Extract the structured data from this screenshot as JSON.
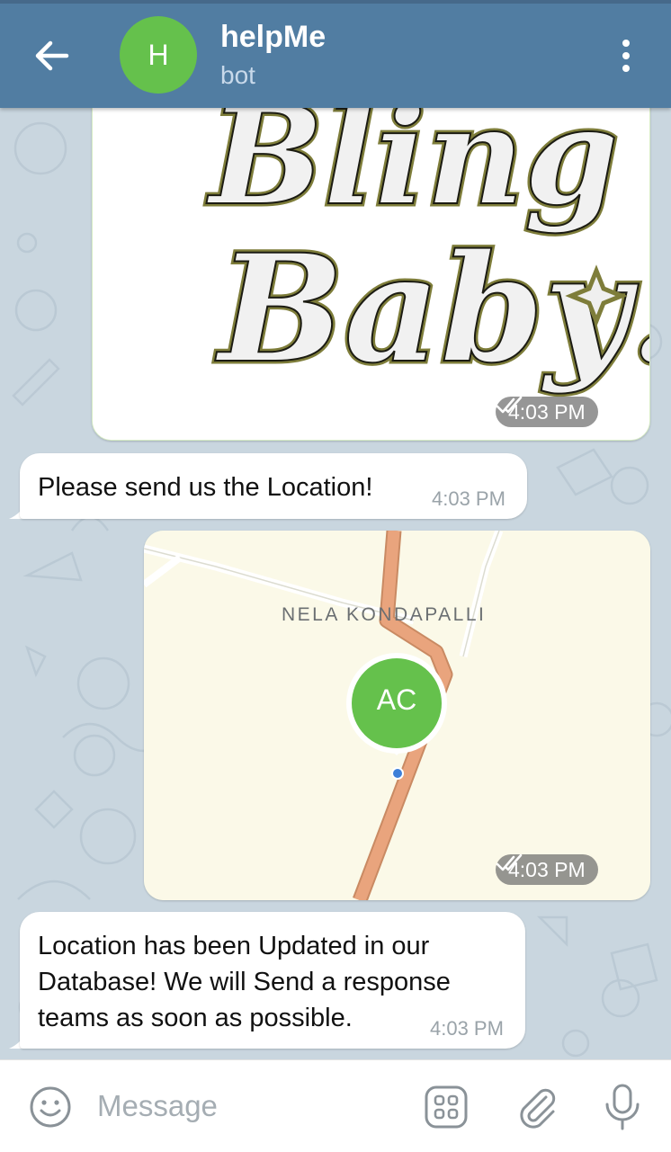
{
  "header": {
    "avatar_letter": "H",
    "title": "helpMe",
    "subtitle": "bot"
  },
  "messages": {
    "sticker": {
      "time": "4:03 PM",
      "status": "read"
    },
    "request": {
      "text": "Please send us the Location!",
      "time": "4:03 PM"
    },
    "location": {
      "place_label": "NELA KONDAPALLI",
      "avatar_initials": "AC",
      "time": "4:03 PM",
      "status": "read"
    },
    "confirmation": {
      "line1": "Location has been Updated in our",
      "line2": "Database! We will Send a response",
      "line3": "teams as soon as possible.",
      "time": "4:03 PM"
    }
  },
  "input": {
    "placeholder": "Message"
  },
  "icons": [
    "back-arrow-icon",
    "more-vert-icon",
    "emoji-icon",
    "bot-commands-icon",
    "attach-icon",
    "microphone-icon",
    "double-check-icon"
  ],
  "colors": {
    "header": "#517da2",
    "avatar": "#65c14c",
    "outgoing_bubble": "#effedd",
    "road": "#e9a47d"
  }
}
